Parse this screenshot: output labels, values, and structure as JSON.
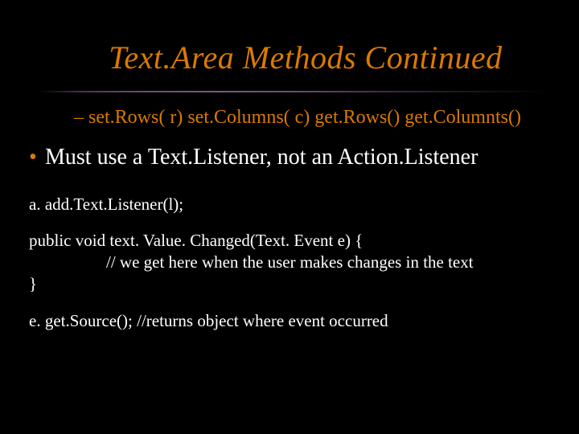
{
  "title": "Text.Area Methods Continued",
  "sub": "set.Rows( r) set.Columns( c) get.Rows() get.Columnts()",
  "bullet": "Must use a Text.Listener, not an Action.Listener",
  "code1": "a. add.Text.Listener(l);",
  "code2_l1": "public void text. Value. Changed(Text. Event e) {",
  "code2_l2": "// we get here when the user makes changes in the text",
  "code2_l3": "}",
  "code3": "e. get.Source(); //returns object where event occurred"
}
